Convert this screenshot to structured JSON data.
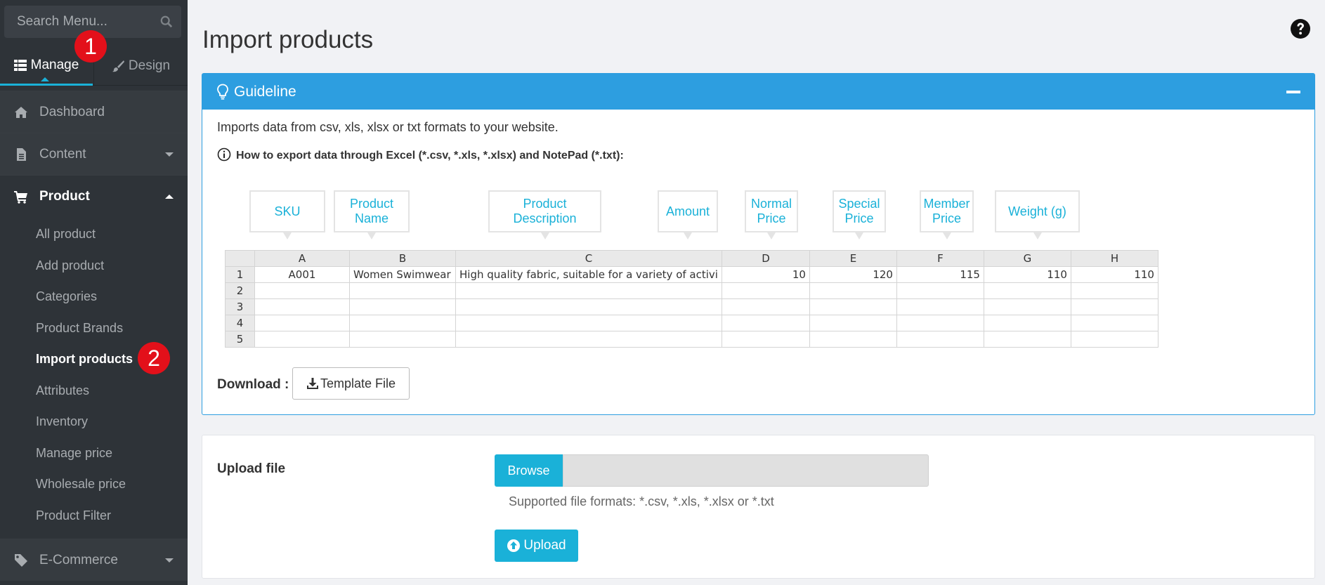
{
  "sidebar": {
    "search_placeholder": "Search Menu...",
    "tabs": {
      "manage": "Manage",
      "design": "Design"
    },
    "badges": {
      "one": "1",
      "two": "2"
    },
    "nav": {
      "dashboard": "Dashboard",
      "content": "Content",
      "product": "Product",
      "ecommerce": "E-Commerce"
    },
    "product_sub": [
      "All product",
      "Add product",
      "Categories",
      "Product Brands",
      "Import products",
      "Attributes",
      "Inventory",
      "Manage price",
      "Wholesale price",
      "Product Filter"
    ],
    "active_sub": "Import products"
  },
  "page": {
    "title": "Import products"
  },
  "guideline": {
    "title": "Guideline",
    "intro": "Imports data from csv, xls, xlsx or txt formats to your website.",
    "howto": "How to export data through Excel (*.csv, *.xls, *.xlsx) and NotePad (*.txt):",
    "callouts": {
      "sku": "SKU",
      "product_name": "Product Name",
      "product_description": "Product Description",
      "amount": "Amount",
      "normal_price": "Normal Price",
      "special_price": "Special Price",
      "member_price": "Member Price",
      "weight": "Weight (g)"
    },
    "sheet": {
      "columns": [
        "A",
        "B",
        "C",
        "D",
        "E",
        "F",
        "G",
        "H"
      ],
      "row_numbers": [
        "1",
        "2",
        "3",
        "4",
        "5"
      ],
      "row1": [
        "A001",
        "Women Swimwear",
        "High quality fabric, suitable for a variety of activi",
        "10",
        "120",
        "115",
        "110",
        "110"
      ]
    },
    "download_label": "Download :",
    "template_button": "Template File"
  },
  "upload": {
    "label": "Upload file",
    "browse": "Browse",
    "formats": "Supported file formats: *.csv, *.xls, *.xlsx or *.txt",
    "button": "Upload"
  },
  "colors": {
    "accent": "#1ab1d8",
    "panel_header": "#2d9ee0",
    "sidebar": "#2e3338",
    "badge": "#e3101a"
  }
}
